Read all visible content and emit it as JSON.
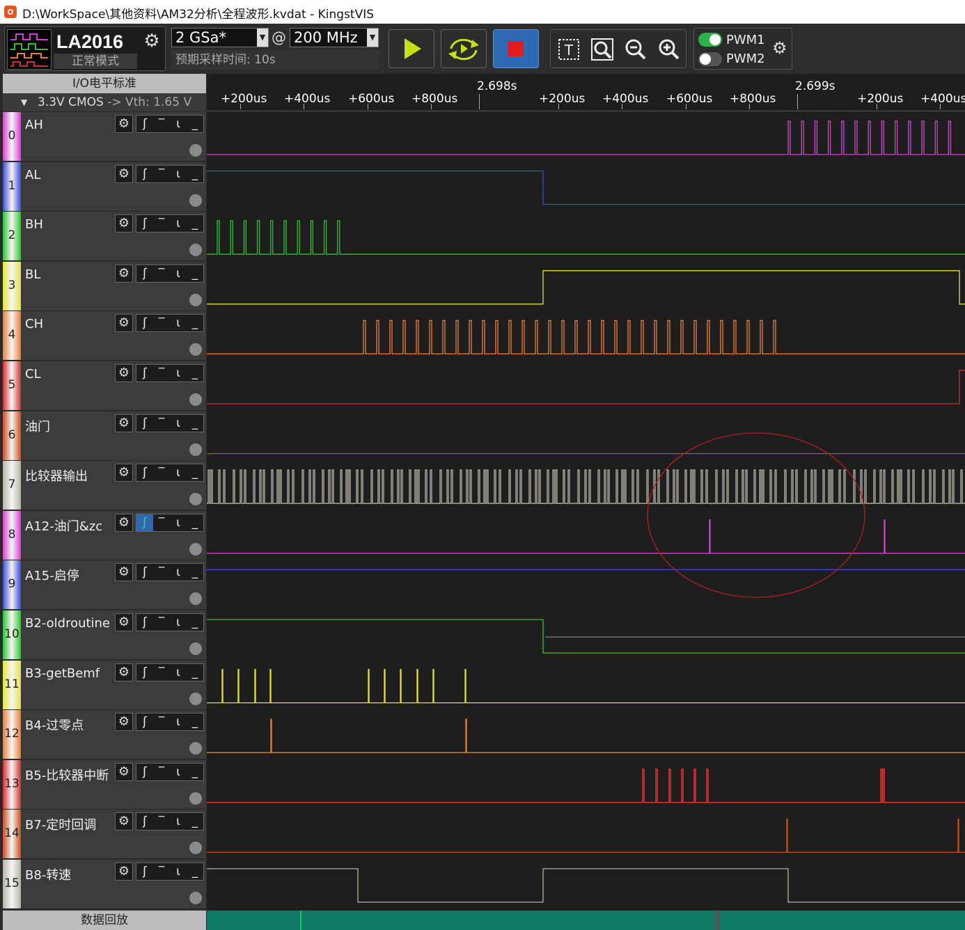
{
  "window": {
    "title": "D:\\WorkSpace\\其他资料\\AM32分析\\全程波形.kvdat - KingstVIS",
    "logo_icon": "kingstvis-logo-icon"
  },
  "toolbar": {
    "device_name": "LA2016",
    "device_mode": "正常模式",
    "sample_rate": "2 GSa*",
    "at_symbol": "@",
    "frequency": "200 MHz",
    "expected_time": "预期采样时间: 10s",
    "buttons": [
      "play-icon",
      "loop-capture-icon",
      "stop-icon"
    ],
    "tools": [
      "text-cursor-icon",
      "zoom-fit-icon",
      "zoom-out-icon",
      "zoom-in-icon"
    ],
    "pwm1": "PWM1",
    "pwm2": "PWM2",
    "pwm1_on": true,
    "pwm2_on": false
  },
  "io": {
    "header": "I/O电平标准",
    "standard": "3.3V CMOS",
    "arrow": "->",
    "threshold": "Vth: 1.65 V"
  },
  "ruler": {
    "major": [
      "2.698s",
      "2.699s"
    ],
    "minor": [
      "+200us",
      "+400us",
      "+600us",
      "+800us",
      "+200us",
      "+400us",
      "+600us",
      "+800us",
      "+200us",
      "+400us"
    ]
  },
  "channels": [
    {
      "num": "0",
      "name": "AH",
      "color": "#d63fd6",
      "trig_active": false
    },
    {
      "num": "1",
      "name": "AL",
      "color": "#3b4fd0",
      "trig_active": false
    },
    {
      "num": "2",
      "name": "BH",
      "color": "#2ec42e",
      "trig_active": false
    },
    {
      "num": "3",
      "name": "BL",
      "color": "#e3e336",
      "trig_active": false
    },
    {
      "num": "4",
      "name": "CH",
      "color": "#e8803a",
      "trig_active": false
    },
    {
      "num": "5",
      "name": "CL",
      "color": "#d63030",
      "trig_active": false
    },
    {
      "num": "6",
      "name": "油门",
      "color": "#c8501e",
      "trig_active": false
    },
    {
      "num": "7",
      "name": "比较器输出",
      "color": "#b5b5a5",
      "trig_active": false
    },
    {
      "num": "8",
      "name": "A12-油门&zc",
      "color": "#d640d6",
      "trig_active": true
    },
    {
      "num": "9",
      "name": "A15-启停",
      "color": "#3b4fd0",
      "trig_active": false
    },
    {
      "num": "10",
      "name": "B2-oldroutine",
      "color": "#2ec42e",
      "trig_active": false
    },
    {
      "num": "11",
      "name": "B3-getBemf",
      "color": "#e3e336",
      "trig_active": false
    },
    {
      "num": "12",
      "name": "B4-过零点",
      "color": "#e8803a",
      "trig_active": false
    },
    {
      "num": "13",
      "name": "B5-比较器中断",
      "color": "#d63030",
      "trig_active": false
    },
    {
      "num": "14",
      "name": "B7-定时回调",
      "color": "#c8501e",
      "trig_active": false
    },
    {
      "num": "15",
      "name": "B8-转速",
      "color": "#b5b5a5",
      "trig_active": false
    }
  ],
  "playback": {
    "label": "数据回放"
  },
  "annotation": {
    "shape": "ellipse",
    "color": "#b02020"
  }
}
